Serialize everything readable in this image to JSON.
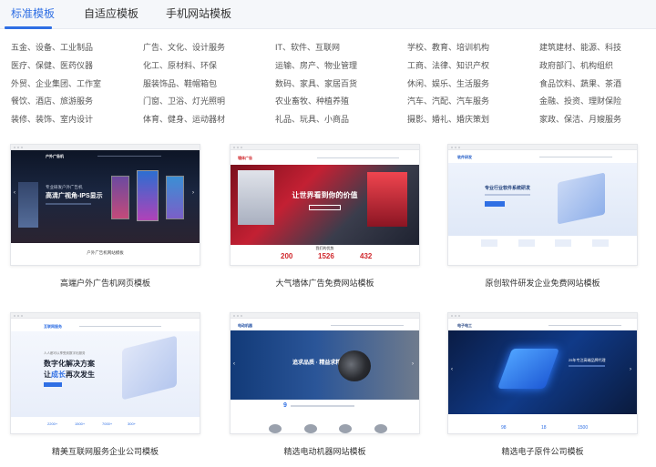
{
  "tabs": [
    {
      "label": "标准模板"
    },
    {
      "label": "自适应模板"
    },
    {
      "label": "手机网站模板"
    }
  ],
  "categories": [
    [
      "五金、设备、工业制品",
      "医疗、保健、医药仪器",
      "外贸、企业集团、工作室",
      "餐饮、酒店、旅游服务",
      "装修、装饰、室内设计"
    ],
    [
      "广告、文化、设计服务",
      "化工、原材料、环保",
      "服装饰品、鞋帽箱包",
      "门窗、卫浴、灯光照明",
      "体育、健身、运动器材"
    ],
    [
      "IT、软件、互联网",
      "运输、房产、物业管理",
      "数码、家具、家居百货",
      "农业畜牧、种植养殖",
      "礼品、玩具、小商品"
    ],
    [
      "学校、教育、培训机构",
      "工商、法律、知识产权",
      "休闲、娱乐、生活服务",
      "汽车、汽配、汽车服务",
      "摄影、婚礼、婚庆策划"
    ],
    [
      "建筑建材、能源、科技",
      "政府部门、机构组织",
      "食品饮料、蔬果、茶酒",
      "金融、投资、理财保险",
      "家政、保洁、月嫂服务"
    ]
  ],
  "cards": [
    {
      "title": "高端户外广告机网页模板",
      "logo": "户外广告机",
      "hero_line1": "专业研发户外广告机",
      "hero_line2": "高清广视角-IPS显示",
      "footer": "户外广告机网站模板"
    },
    {
      "title": "大气墙体广告免费网站模板",
      "logo": "墙体广告",
      "hero_line1": "让世界看到你的价值",
      "section": "我们的优势",
      "stats": [
        "200",
        "1526",
        "432"
      ]
    },
    {
      "title": "原创软件研发企业免费网站模板",
      "logo": "软件研发",
      "hero_line1": "专业行业软件系统研发"
    },
    {
      "title": "精美互联网服务企业公司模板",
      "logo": "互联网服务",
      "hero_line0": "人人都可以享受到数字化服务",
      "hero_line1": "数字化解决方案",
      "hero_line2a": "让",
      "hero_line2b": "成长",
      "hero_line2c": "再次发生",
      "stats": [
        "2200+",
        "1500+",
        "7000+",
        "300+"
      ]
    },
    {
      "title": "精选电动机器网站模板",
      "logo": "电动机器",
      "hero_line1": "追求品质 · 精益求精",
      "years": "9"
    },
    {
      "title": "精选电子原件公司模板",
      "logo": "电子电工",
      "hero_line1": "25年专注高端品牌代理",
      "stats": [
        "98",
        "18",
        "1500"
      ]
    }
  ],
  "colors": {
    "accent": "#2f6fe4",
    "tab_bg": "#f5f7fa",
    "stat_red": "#d0272c"
  }
}
